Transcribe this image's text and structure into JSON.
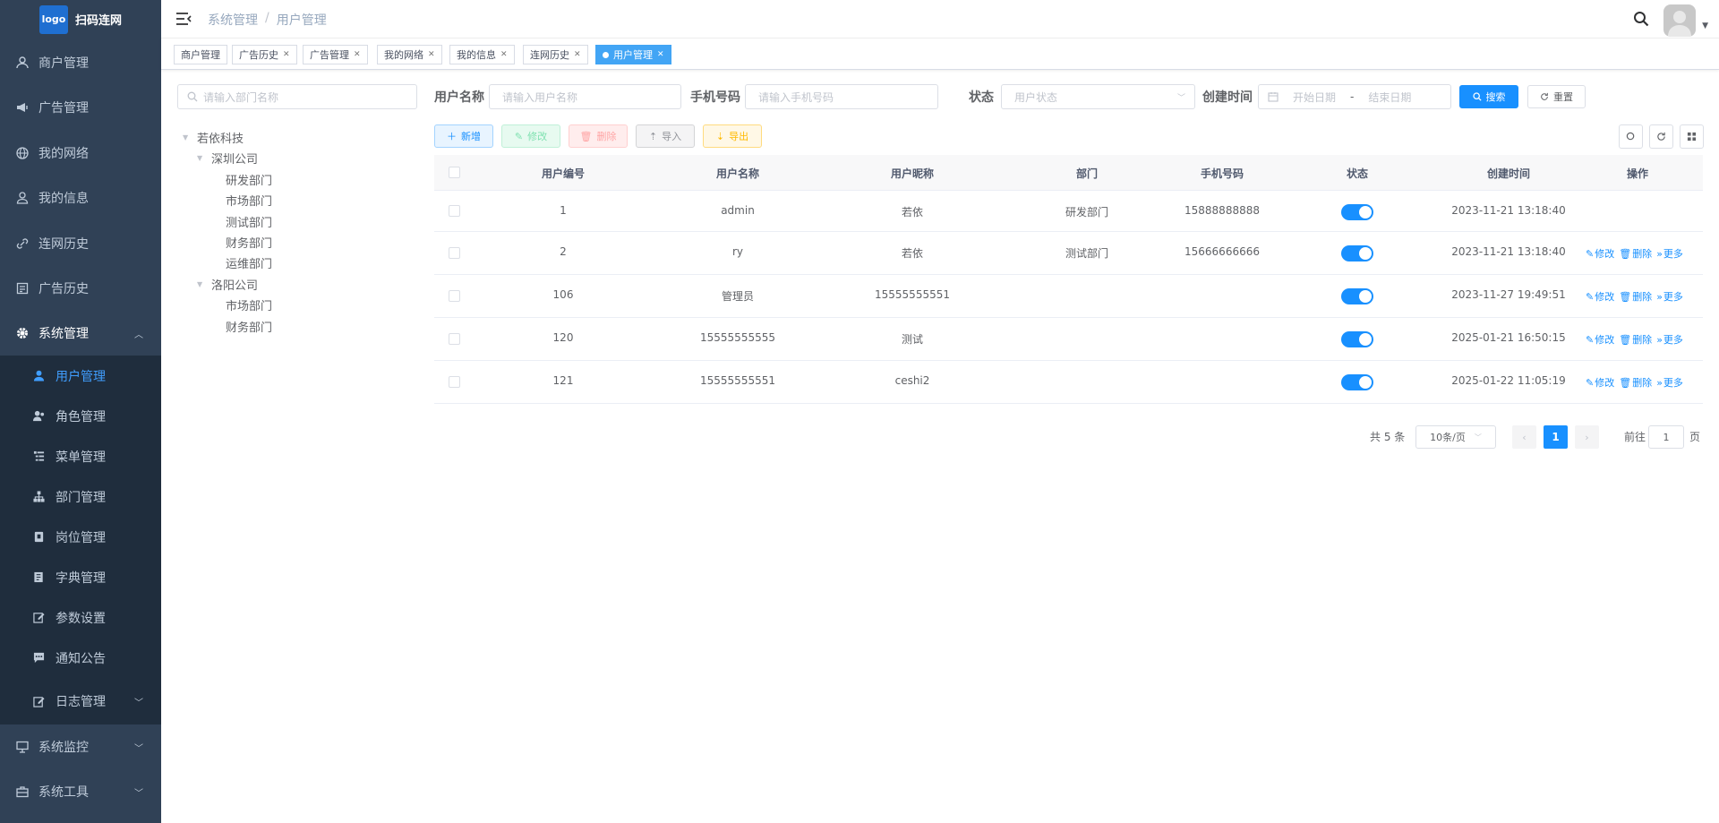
{
  "app": {
    "logo_text": "logo",
    "title": "扫码连网"
  },
  "sidebar": {
    "items": [
      {
        "label": "商户管理",
        "icon": "merchant-icon"
      },
      {
        "label": "广告管理",
        "icon": "megaphone-icon"
      },
      {
        "label": "我的网络",
        "icon": "globe-icon"
      },
      {
        "label": "我的信息",
        "icon": "user-icon"
      },
      {
        "label": "连网历史",
        "icon": "link-icon"
      },
      {
        "label": "广告历史",
        "icon": "ad-history-icon"
      },
      {
        "label": "系统管理",
        "icon": "gear-icon"
      },
      {
        "label": "系统监控",
        "icon": "monitor-icon"
      },
      {
        "label": "系统工具",
        "icon": "toolbox-icon"
      }
    ],
    "sub_items": [
      {
        "label": "用户管理",
        "icon": "user-solid-icon"
      },
      {
        "label": "角色管理",
        "icon": "role-icon"
      },
      {
        "label": "菜单管理",
        "icon": "tree-table-icon"
      },
      {
        "label": "部门管理",
        "icon": "org-tree-icon"
      },
      {
        "label": "岗位管理",
        "icon": "post-icon"
      },
      {
        "label": "字典管理",
        "icon": "dict-icon"
      },
      {
        "label": "参数设置",
        "icon": "edit-icon"
      },
      {
        "label": "通知公告",
        "icon": "message-icon"
      },
      {
        "label": "日志管理",
        "icon": "log-icon"
      }
    ]
  },
  "header": {
    "breadcrumb": [
      "系统管理",
      "/",
      "用户管理"
    ]
  },
  "tags": [
    "商户管理",
    "广告历史",
    "广告管理",
    "我的网络",
    "我的信息",
    "连网历史",
    "用户管理"
  ],
  "dept": {
    "search_placeholder": "请输入部门名称",
    "tree": {
      "root": "若依科技",
      "company1": "深圳公司",
      "c1_children": [
        "研发部门",
        "市场部门",
        "测试部门",
        "财务部门",
        "运维部门"
      ],
      "company2": "洛阳公司",
      "c2_children": [
        "市场部门",
        "财务部门"
      ]
    }
  },
  "filters": {
    "username_label": "用户名称",
    "username_placeholder": "请输入用户名称",
    "phone_label": "手机号码",
    "phone_placeholder": "请输入手机号码",
    "status_label": "状态",
    "status_placeholder": "用户状态",
    "created_label": "创建时间",
    "start_placeholder": "开始日期",
    "date_sep": "-",
    "end_placeholder": "结束日期",
    "search_btn": "搜索",
    "reset_btn": "重置"
  },
  "toolbar": {
    "add": "新增",
    "edit": "修改",
    "delete": "删除",
    "import": "导入",
    "export": "导出"
  },
  "table": {
    "columns": [
      "用户编号",
      "用户名称",
      "用户昵称",
      "部门",
      "手机号码",
      "状态",
      "创建时间",
      "操作"
    ],
    "rows": [
      {
        "id": "1",
        "username": "admin",
        "nickname": "若依",
        "dept": "研发部门",
        "phone": "15888888888",
        "status": true,
        "created": "2023-11-21 13:18:40",
        "ops": []
      },
      {
        "id": "2",
        "username": "ry",
        "nickname": "若依",
        "dept": "测试部门",
        "phone": "15666666666",
        "status": true,
        "created": "2023-11-21 13:18:40",
        "ops": [
          "修改",
          "删除",
          "更多"
        ]
      },
      {
        "id": "106",
        "username": "管理员",
        "nickname": "15555555551",
        "dept": "",
        "phone": "",
        "status": true,
        "created": "2023-11-27 19:49:51",
        "ops": [
          "修改",
          "删除",
          "更多"
        ]
      },
      {
        "id": "120",
        "username": "15555555555",
        "nickname": "测试",
        "dept": "",
        "phone": "",
        "status": true,
        "created": "2025-01-21 16:50:15",
        "ops": [
          "修改",
          "删除",
          "更多"
        ]
      },
      {
        "id": "121",
        "username": "15555555551",
        "nickname": "ceshi2",
        "dept": "",
        "phone": "",
        "status": true,
        "created": "2025-01-22 11:05:19",
        "ops": [
          "修改",
          "删除",
          "更多"
        ]
      }
    ]
  },
  "pagination": {
    "total": "共 5 条",
    "page_size": "10条/页",
    "current": "1",
    "goto_label": "前往",
    "goto_value": "1",
    "page_suffix": "页"
  },
  "colors": {
    "sidebar_bg": "#304156",
    "submenu_bg": "#1f2d3d",
    "primary": "#1890ff",
    "active_tag": "#42a5f5"
  }
}
